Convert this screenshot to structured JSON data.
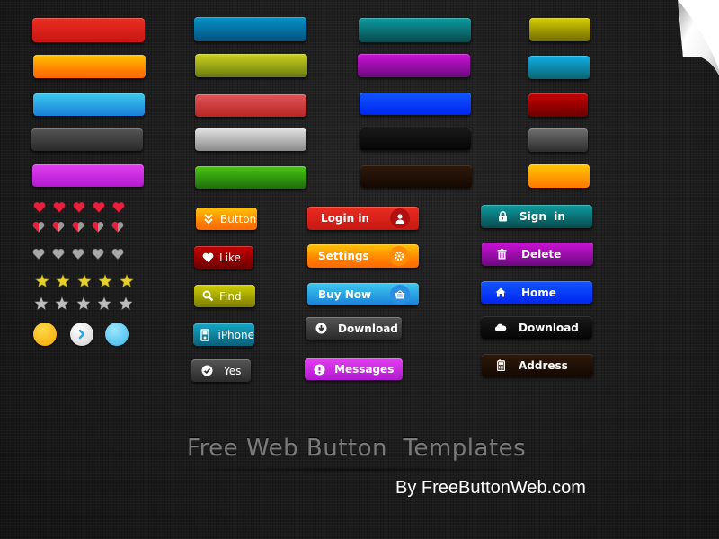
{
  "title": "Free Web Button  Templates",
  "credit": "By FreeButtonWeb.com",
  "colors": {
    "background": "#1c1c1c",
    "title_text": "#7a7a7a",
    "credit_text": "#ffffff"
  },
  "plain_buttons": {
    "column_1": [
      "red",
      "orange",
      "sky-blue",
      "dark-gray",
      "magenta"
    ],
    "column_2": [
      "blue",
      "olive",
      "salmon-red",
      "silver",
      "green"
    ],
    "column_3": [
      "teal",
      "purple",
      "royal-blue",
      "black",
      "brown"
    ],
    "column_4": [
      "yellow",
      "cyan",
      "crimson",
      "graphite",
      "amber"
    ]
  },
  "ratings": {
    "full_hearts": 5,
    "half_hearts": 5,
    "empty_hearts": 5,
    "gold_stars": 5,
    "gray_stars": 5,
    "circles": [
      "yellow-circle",
      "white-arrow-circle",
      "blue-circle"
    ]
  },
  "small_buttons": [
    {
      "label": "Button",
      "icon": "double-chevron-down-icon",
      "color": "orange"
    },
    {
      "label": "Like",
      "icon": "heart-icon",
      "color": "red"
    },
    {
      "label": "Find",
      "icon": "search-icon",
      "color": "yellow"
    },
    {
      "label": "iPhone",
      "icon": "ipod-icon",
      "color": "teal"
    },
    {
      "label": "Yes",
      "icon": "check-circle-icon",
      "color": "gray"
    }
  ],
  "icon_buttons": [
    {
      "label": "Login in",
      "icon": "user-icon",
      "color": "red"
    },
    {
      "label": "Settings",
      "icon": "gear-icon",
      "color": "orange"
    },
    {
      "label": "Buy Now",
      "icon": "basket-icon",
      "color": "sky-blue"
    },
    {
      "label": "Download",
      "icon": "download-circle-icon",
      "color": "dark-gray"
    },
    {
      "label": "Messages",
      "icon": "exclamation-circle-icon",
      "color": "magenta"
    }
  ],
  "wide_buttons": [
    {
      "label": "Sign  in",
      "icon": "lock-icon",
      "color": "teal"
    },
    {
      "label": "Delete",
      "icon": "trash-icon",
      "color": "purple"
    },
    {
      "label": "Home",
      "icon": "home-icon",
      "color": "blue"
    },
    {
      "label": "Download",
      "icon": "cloud-icon",
      "color": "black"
    },
    {
      "label": "Address",
      "icon": "mobile-phone-icon",
      "color": "brown"
    }
  ]
}
